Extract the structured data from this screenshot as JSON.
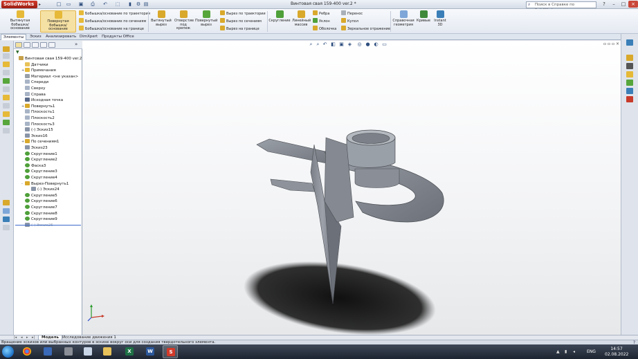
{
  "app": {
    "logo": "SolidWorks",
    "document_title": "Винтовая свая 159-400 ver.2 *",
    "help_search_placeholder": "Поиск в Справке по SolidWorks",
    "colors": {
      "accent": "#c9473a",
      "ribbon_highlight": "#f6e1a4",
      "model_gray": "#8a8e96"
    }
  },
  "quick_access": [
    "new-icon",
    "open-icon",
    "save-icon",
    "print-icon",
    "undo-icon",
    "select-icon",
    "rebuild-icon",
    "options-icon"
  ],
  "ribbon": {
    "extruded_boss": "Вытянутая бобышка/основание",
    "revolved_boss": "Повернутая бобышка/основание",
    "swept_boss": "Бобышка/основание по траектории",
    "lofted_boss": "Бобышка/основание по сечениям",
    "boundary_boss": "Бобышка/основание на границе",
    "extruded_cut": "Вытянутый вырез",
    "hole_wizard": "Отверстие под крепеж",
    "revolved_cut": "Повернутый вырез",
    "swept_cut": "Вырез по траектории",
    "lofted_cut": "Вырез по сечениям",
    "boundary_cut": "Вырез на границе",
    "fillet": "Скругление",
    "linear_pattern": "Линейный массив",
    "rib": "Ребра",
    "draft": "Уклон",
    "shell": "Оболочка",
    "wrap": "Перенос",
    "dome": "Купол",
    "mirror": "Зеркальное отражение",
    "ref_geometry": "Справочная геометрия",
    "curves": "Кривые",
    "instant3d": "Instant 3D"
  },
  "command_tabs": [
    "Элементы",
    "Эскиз",
    "Анализировать",
    "DimXpert",
    "Продукты Office"
  ],
  "tree": {
    "filter_icon": "filter-icon",
    "items": [
      {
        "label": "Винтовая свая 159-400 ver.2  (По..",
        "icon": "part",
        "indent": 0,
        "exp": ""
      },
      {
        "label": "Датчики",
        "icon": "folder",
        "indent": 1,
        "exp": ""
      },
      {
        "label": "Примечания",
        "icon": "note",
        "indent": 1,
        "exp": "+"
      },
      {
        "label": "Материал <не указан>",
        "icon": "material",
        "indent": 1,
        "exp": ""
      },
      {
        "label": "Спереди",
        "icon": "plane",
        "indent": 1,
        "exp": ""
      },
      {
        "label": "Сверху",
        "icon": "plane",
        "indent": 1,
        "exp": ""
      },
      {
        "label": "Справа",
        "icon": "plane",
        "indent": 1,
        "exp": ""
      },
      {
        "label": "Исходная точка",
        "icon": "origin",
        "indent": 1,
        "exp": ""
      },
      {
        "label": "Повернуть1",
        "icon": "feature",
        "indent": 1,
        "exp": "+"
      },
      {
        "label": "Плоскость1",
        "icon": "plane",
        "indent": 1,
        "exp": ""
      },
      {
        "label": "Плоскость2",
        "icon": "plane",
        "indent": 1,
        "exp": ""
      },
      {
        "label": "Плоскость3",
        "icon": "plane",
        "indent": 1,
        "exp": ""
      },
      {
        "label": "(-) Эскиз15",
        "icon": "sketch",
        "indent": 1,
        "exp": ""
      },
      {
        "label": "Эскиз16",
        "icon": "sketch",
        "indent": 1,
        "exp": ""
      },
      {
        "label": "По сечениям1",
        "icon": "feature",
        "indent": 1,
        "exp": "+"
      },
      {
        "label": "Эскиз23",
        "icon": "sketch",
        "indent": 1,
        "exp": ""
      },
      {
        "label": "Скругление1",
        "icon": "fillet",
        "indent": 1,
        "exp": ""
      },
      {
        "label": "Скругление2",
        "icon": "fillet",
        "indent": 1,
        "exp": ""
      },
      {
        "label": "Фаска3",
        "icon": "fillet",
        "indent": 1,
        "exp": ""
      },
      {
        "label": "Скругление3",
        "icon": "fillet",
        "indent": 1,
        "exp": ""
      },
      {
        "label": "Скругление4",
        "icon": "fillet",
        "indent": 1,
        "exp": ""
      },
      {
        "label": "Вырез-Повернуть1",
        "icon": "feature",
        "indent": 1,
        "exp": "-"
      },
      {
        "label": "(-) Эскиз24",
        "icon": "sketch",
        "indent": 2,
        "exp": ""
      },
      {
        "label": "Скругление5",
        "icon": "fillet",
        "indent": 1,
        "exp": ""
      },
      {
        "label": "Скругление6",
        "icon": "fillet",
        "indent": 1,
        "exp": ""
      },
      {
        "label": "Скругление7",
        "icon": "fillet",
        "indent": 1,
        "exp": ""
      },
      {
        "label": "Скругление8",
        "icon": "fillet",
        "indent": 1,
        "exp": ""
      },
      {
        "label": "Скругление9",
        "icon": "fillet",
        "indent": 1,
        "exp": ""
      },
      {
        "label": "(-) Эскиз25",
        "icon": "sketch",
        "indent": 1,
        "exp": "",
        "dim": true
      }
    ]
  },
  "bottom_tabs": [
    "Модель",
    "Исследование движения 1"
  ],
  "status": {
    "text": "Вращение эскизов или выбранных контуров в эскизе вокруг оси для создания твердотельного элемента.",
    "help_icon": "help-icon"
  },
  "taskbar": {
    "apps": [
      "chrome",
      "explorer-pin",
      "tool",
      "notepad",
      "folder",
      "excel",
      "word",
      "solidworks"
    ],
    "language": "ENG",
    "time": "14:57",
    "date": "02.08.2022"
  }
}
